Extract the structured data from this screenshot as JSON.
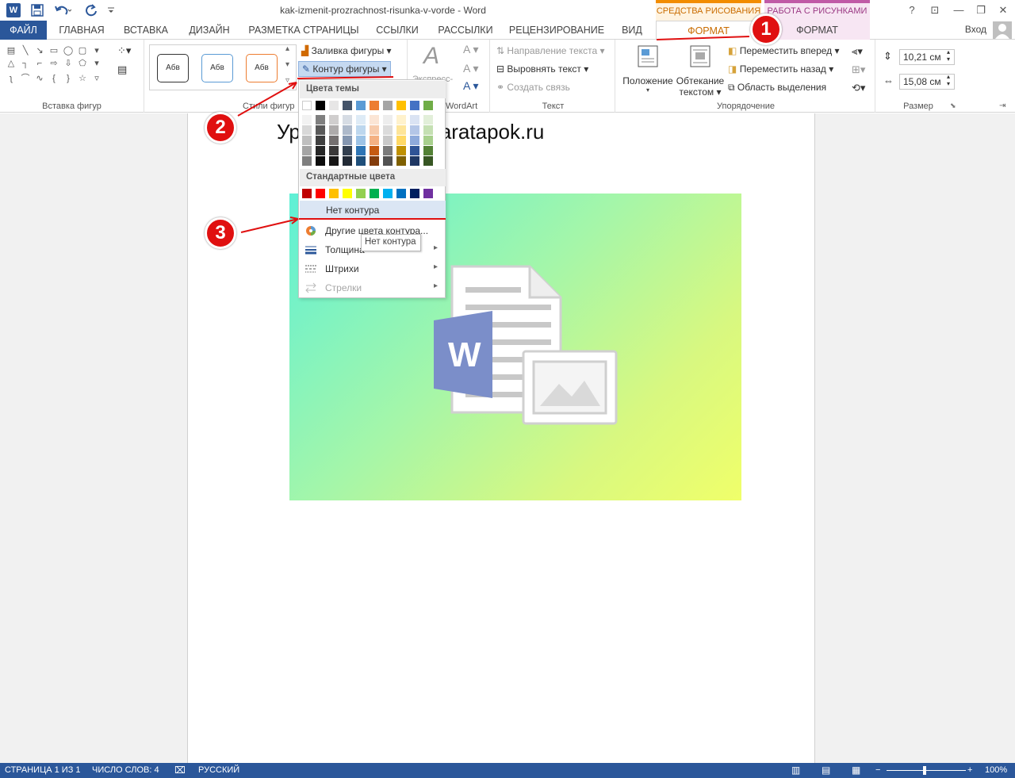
{
  "titlebar": {
    "title": "kak-izmenit-prozrachnost-risunka-v-vorde - Word",
    "app_icon": "W",
    "context_drawing": "СРЕДСТВА РИСОВАНИЯ",
    "context_picture": "РАБОТА С РИСУНКАМИ",
    "help": "?",
    "ribbon_display": "⊡",
    "minimize": "—",
    "restore": "❐",
    "close": "✕"
  },
  "tabs": {
    "file": "ФАЙЛ",
    "home": "ГЛАВНАЯ",
    "insert": "ВСТАВКА",
    "design": "ДИЗАЙН",
    "layout": "РАЗМЕТКА СТРАНИЦЫ",
    "references": "ССЫЛКИ",
    "mailings": "РАССЫЛКИ",
    "review": "РЕЦЕНЗИРОВАНИЕ",
    "view": "ВИД",
    "format_drawing": "ФОРМАТ",
    "format_picture": "ФОРМАТ",
    "signin": "Вход"
  },
  "ribbon": {
    "insert_shapes_label": "Вставка фигур",
    "shape_styles_label": "Стили фигур",
    "style_swatch": "Абв",
    "fill_label": "Заливка фигуры",
    "outline_label": "Контур фигуры",
    "express_label": "Экспресс-",
    "wordart_label": "WordArt",
    "text_direction": "Направление текста",
    "align_text": "Выровнять текст",
    "create_link": "Создать связь",
    "text_group_label": "Текст",
    "position": "Положение",
    "wrap_text_1": "Обтекание",
    "wrap_text_2": "текстом",
    "bring_forward": "Переместить вперед",
    "send_backward": "Переместить назад",
    "selection_pane": "Область выделения",
    "arrange_label": "Упорядочение",
    "height_value": "10,21 см",
    "width_value": "15,08 см",
    "size_label": "Размер"
  },
  "document": {
    "heading_left": "Ур",
    "heading_right": "aratapok.ru"
  },
  "dropdown": {
    "theme_colors_header": "Цвета темы",
    "standard_colors_header": "Стандартные цвета",
    "no_outline": "Нет контура",
    "more_colors": "Другие цвета контура...",
    "weight": "Толщина",
    "dashes": "Штрихи",
    "arrows": "Стрелки",
    "tooltip": "Нет контура",
    "theme_row": [
      "#ffffff",
      "#000000",
      "#e7e6e6",
      "#44546a",
      "#5b9bd5",
      "#ed7d31",
      "#a5a5a5",
      "#ffc000",
      "#4472c4",
      "#70ad47"
    ],
    "theme_shades": [
      [
        "#f2f2f2",
        "#7f7f7f",
        "#d0cece",
        "#d6dce4",
        "#deebf6",
        "#fbe5d5",
        "#ededed",
        "#fff2cc",
        "#dae3f3",
        "#e2efd9"
      ],
      [
        "#d8d8d8",
        "#595959",
        "#aeabab",
        "#adb9ca",
        "#bdd7ee",
        "#f7cbac",
        "#dbdbdb",
        "#fee599",
        "#b4c6e7",
        "#c5e0b3"
      ],
      [
        "#bfbfbf",
        "#3f3f3f",
        "#757070",
        "#8496b0",
        "#9dc3e6",
        "#f4b183",
        "#c9c9c9",
        "#ffd965",
        "#8eaadb",
        "#a8d08d"
      ],
      [
        "#a5a5a5",
        "#262626",
        "#3a3838",
        "#323f4f",
        "#2e75b5",
        "#c55a11",
        "#7b7b7b",
        "#bf9000",
        "#2f5496",
        "#538135"
      ],
      [
        "#7f7f7f",
        "#0c0c0c",
        "#171616",
        "#222a35",
        "#1e4e79",
        "#833c0b",
        "#525252",
        "#7f6000",
        "#1f3864",
        "#375623"
      ]
    ],
    "standard_row": [
      "#c00000",
      "#ff0000",
      "#ffc000",
      "#ffff00",
      "#92d050",
      "#00b050",
      "#00b0f0",
      "#0070c0",
      "#002060",
      "#7030a0"
    ]
  },
  "annotations": {
    "marker_1": "1",
    "marker_2": "2",
    "marker_3": "3",
    "annotation_color": "#e01010"
  },
  "statusbar": {
    "page": "СТРАНИЦА 1 ИЗ 1",
    "words": "ЧИСЛО СЛОВ: 4",
    "language": "РУССКИЙ",
    "zoom": "100%",
    "zoom_minus": "−",
    "zoom_plus": "+"
  },
  "colors": {
    "word_blue": "#2b579a",
    "drawing_accent": "#f28c00",
    "picture_accent": "#c05aa6"
  }
}
